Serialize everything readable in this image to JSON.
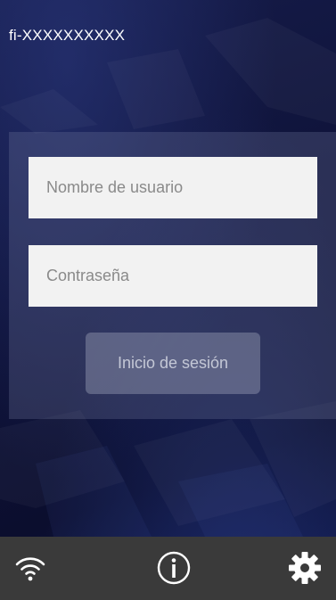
{
  "device": {
    "name": "fi-XXXXXXXXXX"
  },
  "login": {
    "username_placeholder": "Nombre de usuario",
    "username_value": "",
    "password_placeholder": "Contraseña",
    "password_value": "",
    "submit_label": "Inicio de sesión"
  },
  "toolbar": {
    "icons": [
      "wifi-icon",
      "info-icon",
      "gear-icon"
    ]
  },
  "colors": {
    "background_dark": "#0e1238",
    "panel_overlay": "#787da0",
    "field_background": "#f2f2f2",
    "bottom_bar": "#3a3a3a",
    "icon": "#ffffff"
  }
}
